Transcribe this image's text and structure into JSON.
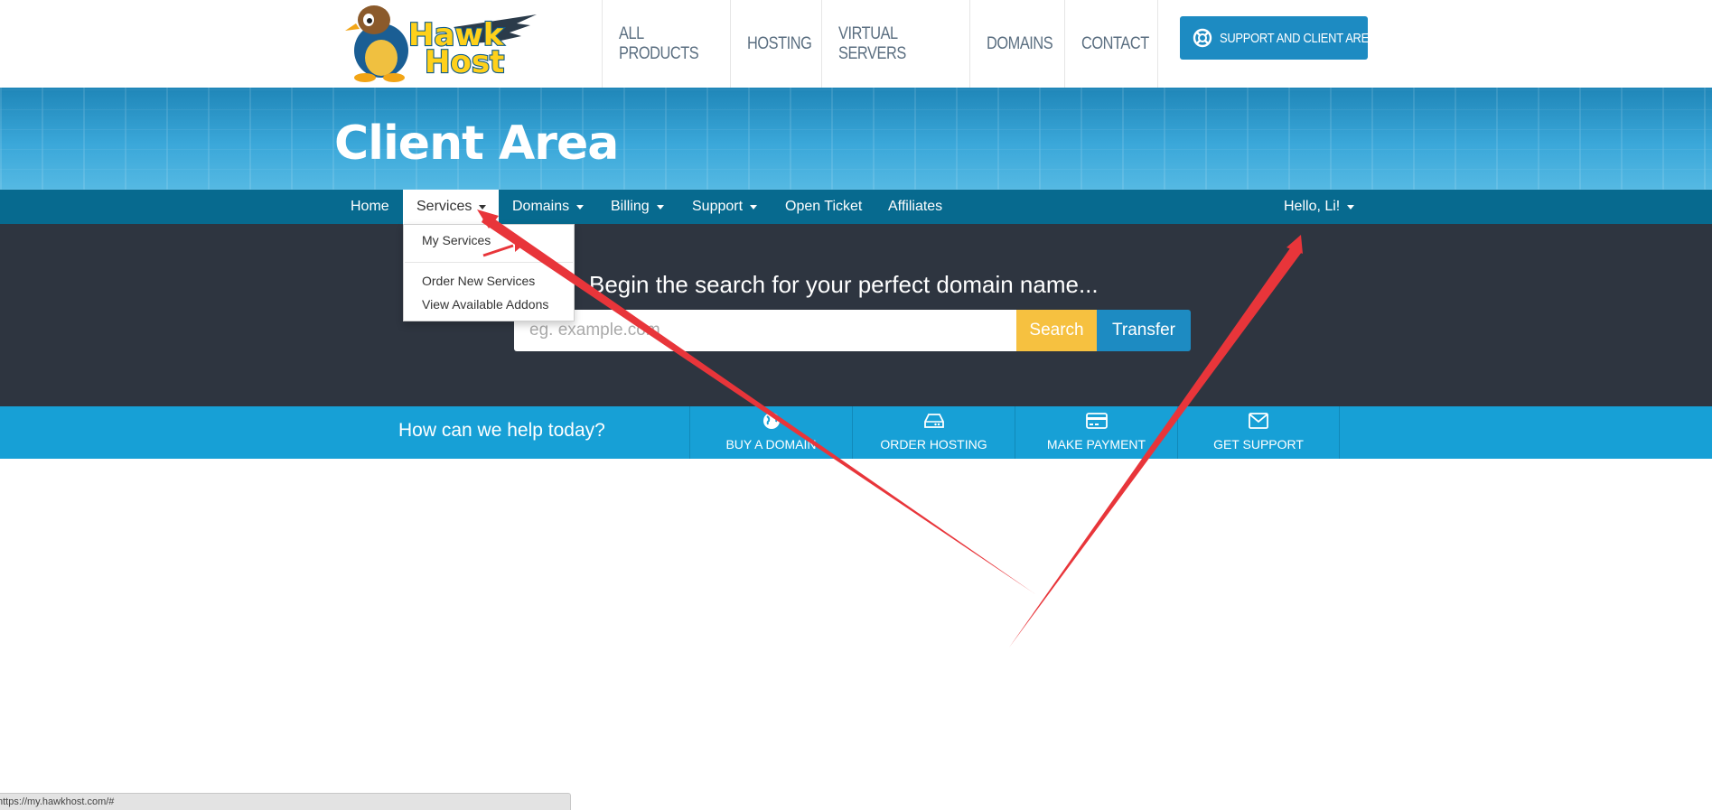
{
  "brand": {
    "logo_text_1": "Hawk",
    "logo_text_2": "Host"
  },
  "header_nav": [
    {
      "label": "ALL PRODUCTS"
    },
    {
      "label": "HOSTING"
    },
    {
      "label": "VIRTUAL SERVERS"
    },
    {
      "label": "DOMAINS"
    },
    {
      "label": "CONTACT"
    }
  ],
  "support_button": {
    "label": "SUPPORT AND CLIENT AREA",
    "icon": "lifebuoy-icon"
  },
  "banner": {
    "title": "Client Area"
  },
  "client_nav": {
    "home": "Home",
    "services": "Services",
    "domains": "Domains",
    "billing": "Billing",
    "support": "Support",
    "open_ticket": "Open Ticket",
    "affiliates": "Affiliates",
    "greeting": "Hello, Li!",
    "active": "Services"
  },
  "services_dropdown": {
    "items": [
      "My Services",
      "Order New Services",
      "View Available Addons"
    ]
  },
  "domain_search": {
    "heading": "Begin the search for your perfect domain name...",
    "placeholder": "eg. example.com",
    "search_label": "Search",
    "transfer_label": "Transfer"
  },
  "help_bar": {
    "question": "How can we help today?",
    "tiles": [
      {
        "label": "BUY A DOMAIN",
        "icon": "globe-icon"
      },
      {
        "label": "ORDER HOSTING",
        "icon": "hdd-icon"
      },
      {
        "label": "MAKE PAYMENT",
        "icon": "credit-card-icon"
      },
      {
        "label": "GET SUPPORT",
        "icon": "envelope-icon"
      }
    ]
  },
  "status_bar": {
    "url": "https://my.hawkhost.com/#"
  },
  "colors": {
    "header_bg": "#ffffff",
    "banner_blue": "#3aa7d9",
    "nav_bar": "#076a8f",
    "search_bg": "#2e3540",
    "search_button": "#f6c140",
    "transfer_button": "#1d8bc2",
    "help_bar": "#17a0d6",
    "annotation_arrow": "#e8353a"
  }
}
